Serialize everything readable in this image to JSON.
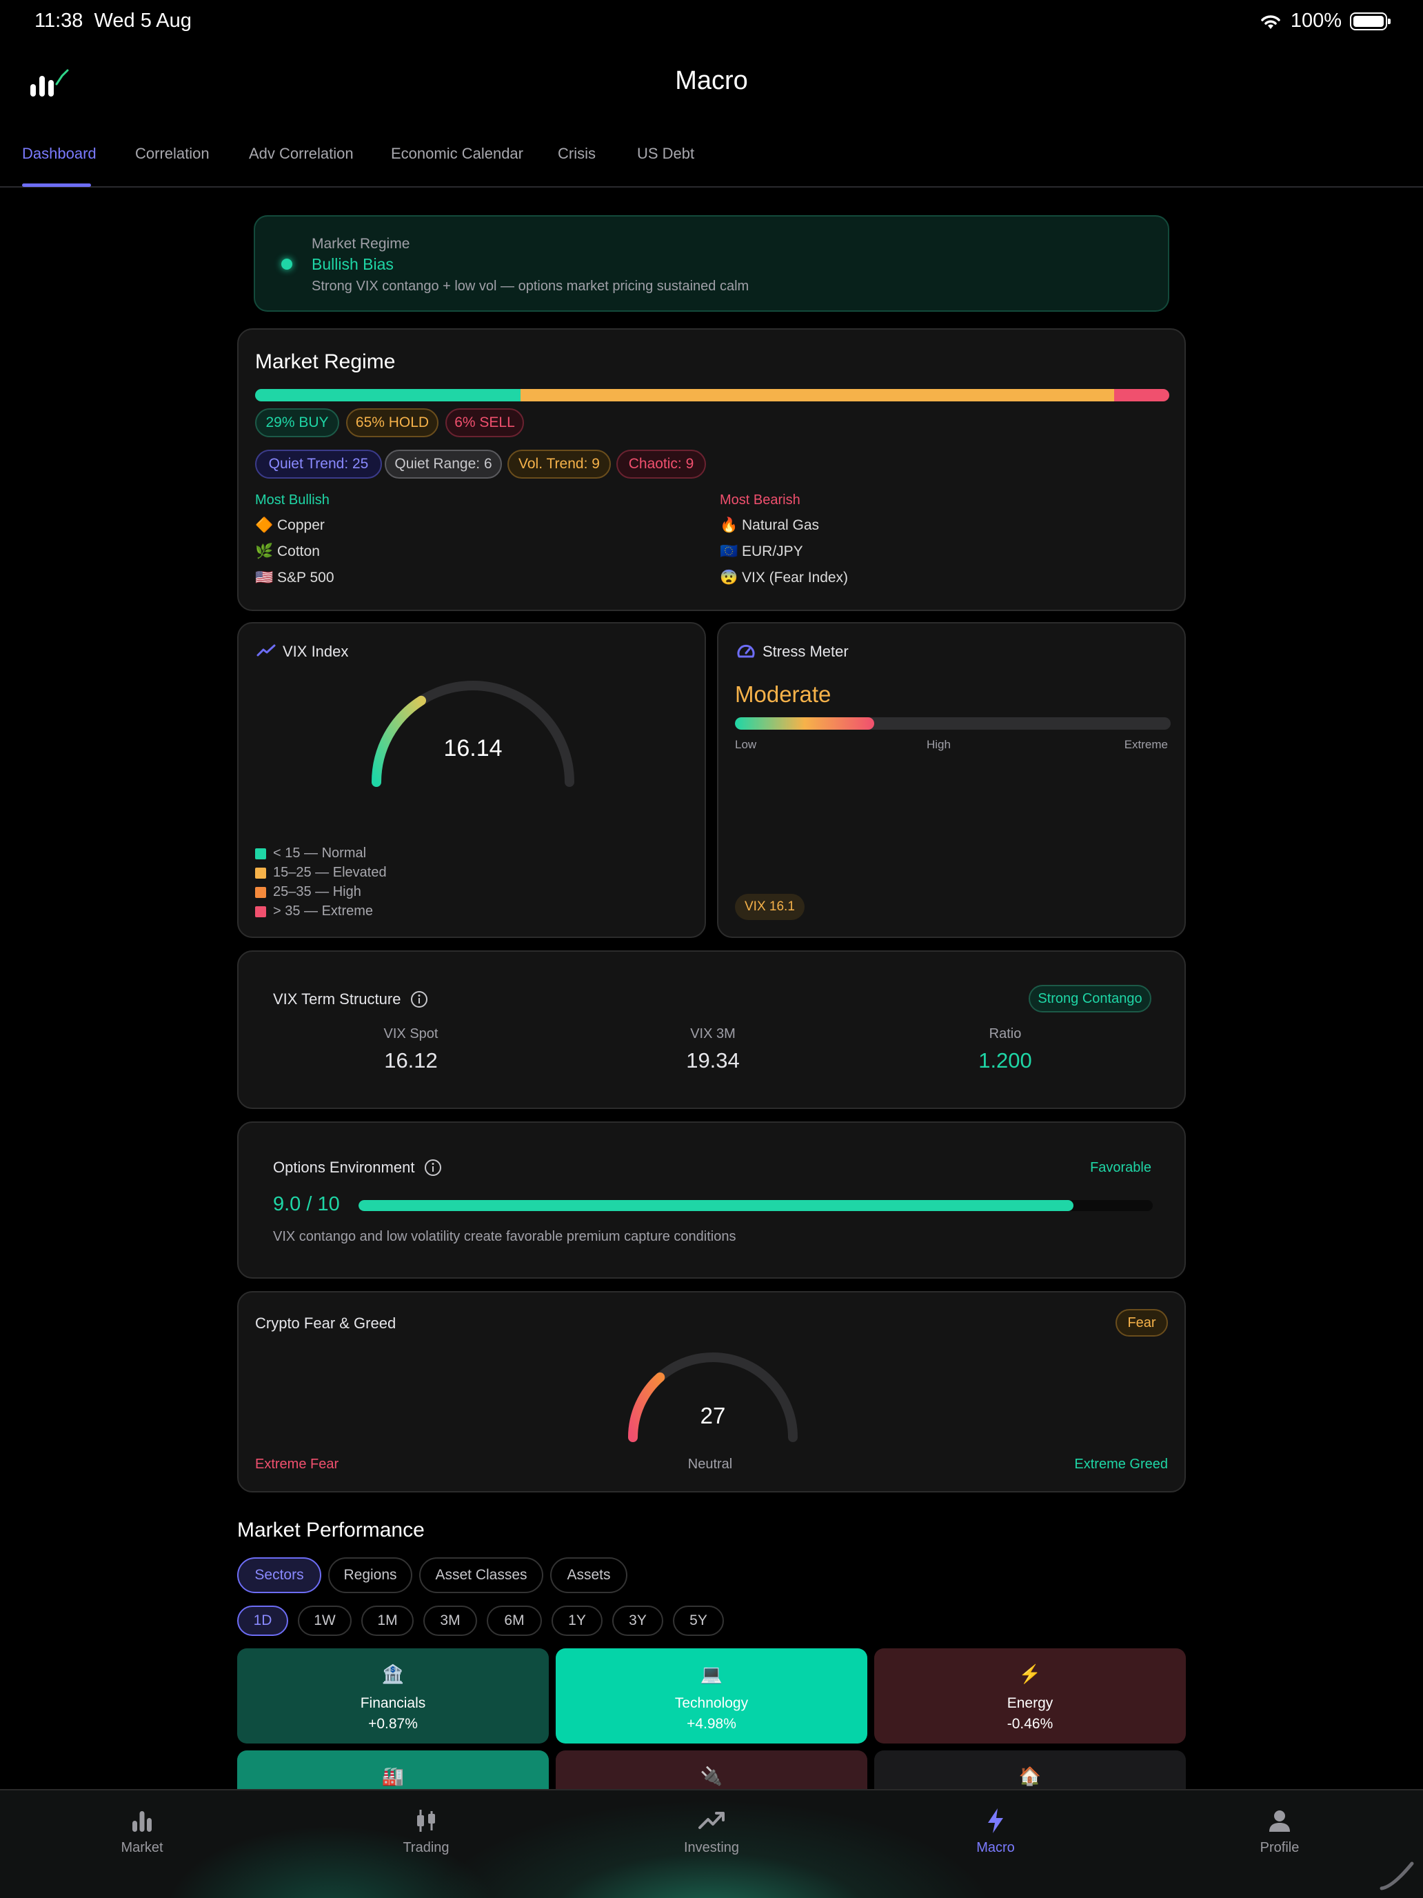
{
  "status_bar": {
    "time": "11:38",
    "date": "Wed 5 Aug",
    "battery": "100%"
  },
  "header": {
    "title": "Macro",
    "logo_icon": "bar-chart-logo-icon"
  },
  "tabs": [
    {
      "label": "Dashboard",
      "active": true
    },
    {
      "label": "Correlation"
    },
    {
      "label": "Adv Correlation"
    },
    {
      "label": "Economic Calendar"
    },
    {
      "label": "Crisis"
    },
    {
      "label": "US Debt"
    }
  ],
  "regime_banner": {
    "label": "Market Regime",
    "bias": "Bullish Bias",
    "description": "Strong VIX contango + low vol — options market pricing sustained calm"
  },
  "market_regime": {
    "title": "Market Regime",
    "split": {
      "buy": 0.29,
      "hold": 0.65,
      "sell": 0.06
    },
    "pills": [
      "29% BUY",
      "65% HOLD",
      "6% SELL"
    ],
    "regime_counts": [
      "Quiet Trend: 25",
      "Quiet Range: 6",
      "Vol. Trend: 9",
      "Chaotic: 9"
    ],
    "most_bullish_label": "Most Bullish",
    "most_bullish": [
      {
        "emoji": "🔶",
        "name": "Copper"
      },
      {
        "emoji": "🌿",
        "name": "Cotton"
      },
      {
        "emoji": "🇺🇸",
        "name": "S&P 500"
      }
    ],
    "most_bearish_label": "Most Bearish",
    "most_bearish": [
      {
        "emoji": "🔥",
        "name": "Natural Gas"
      },
      {
        "emoji": "🇪🇺",
        "name": "EUR/JPY"
      },
      {
        "emoji": "😨",
        "name": "VIX (Fear Index)"
      }
    ]
  },
  "vix_index": {
    "title": "VIX Index",
    "value": "16.14",
    "gauge_fraction": 0.32,
    "legend": [
      "< 15 — Normal",
      "15–25 — Elevated",
      "25–35 — High",
      "> 35 — Extreme"
    ],
    "legend_colors": [
      "#1fd6a6",
      "#f6b24a",
      "#f58a3c",
      "#f0506e"
    ]
  },
  "stress_meter": {
    "title": "Stress Meter",
    "level": "Moderate",
    "fill_fraction": 0.32,
    "scale": [
      "Low",
      "High",
      "Extreme"
    ],
    "badge": "VIX 16.1"
  },
  "vix_term": {
    "title": "VIX Term Structure",
    "status": "Strong Contango",
    "metrics": [
      {
        "label": "VIX Spot",
        "value": "16.12"
      },
      {
        "label": "VIX 3M",
        "value": "19.34"
      },
      {
        "label": "Ratio",
        "value": "1.200"
      }
    ]
  },
  "options_env": {
    "title": "Options Environment",
    "status": "Favorable",
    "score": "9.0 / 10",
    "score_fraction": 0.9,
    "description": "VIX contango and low volatility create favorable premium capture conditions"
  },
  "crypto_fg": {
    "title": "Crypto Fear & Greed",
    "badge": "Fear",
    "value": "27",
    "gauge_fraction": 0.27,
    "left_label": "Extreme Fear",
    "center_label": "Neutral",
    "right_label": "Extreme Greed"
  },
  "market_performance": {
    "title": "Market Performance",
    "categories": [
      "Sectors",
      "Regions",
      "Asset Classes",
      "Assets"
    ],
    "periods": [
      "1D",
      "1W",
      "1M",
      "3M",
      "6M",
      "1Y",
      "3Y",
      "5Y"
    ],
    "tiles": [
      {
        "icon": "🏦",
        "name": "Financials",
        "change": "+0.87%",
        "color": "#0e4d40"
      },
      {
        "icon": "💻",
        "name": "Technology",
        "change": "+4.98%",
        "color": "#05d4a8"
      },
      {
        "icon": "⚡",
        "name": "Energy",
        "change": "-0.46%",
        "color": "#3d1a1e"
      },
      {
        "icon": "🏭",
        "name": "",
        "change": "",
        "color": "#0f8a6e"
      },
      {
        "icon": "🔌",
        "name": "",
        "change": "",
        "color": "#3a1b20"
      },
      {
        "icon": "🏠",
        "name": "",
        "change": "",
        "color": "#1a1a1c"
      }
    ]
  },
  "bottom_nav": [
    {
      "label": "Market",
      "icon": "bar-chart-icon"
    },
    {
      "label": "Trading",
      "icon": "candlestick-icon"
    },
    {
      "label": "Investing",
      "icon": "trend-up-icon"
    },
    {
      "label": "Macro",
      "icon": "lightning-icon",
      "active": true
    },
    {
      "label": "Profile",
      "icon": "person-icon"
    }
  ]
}
